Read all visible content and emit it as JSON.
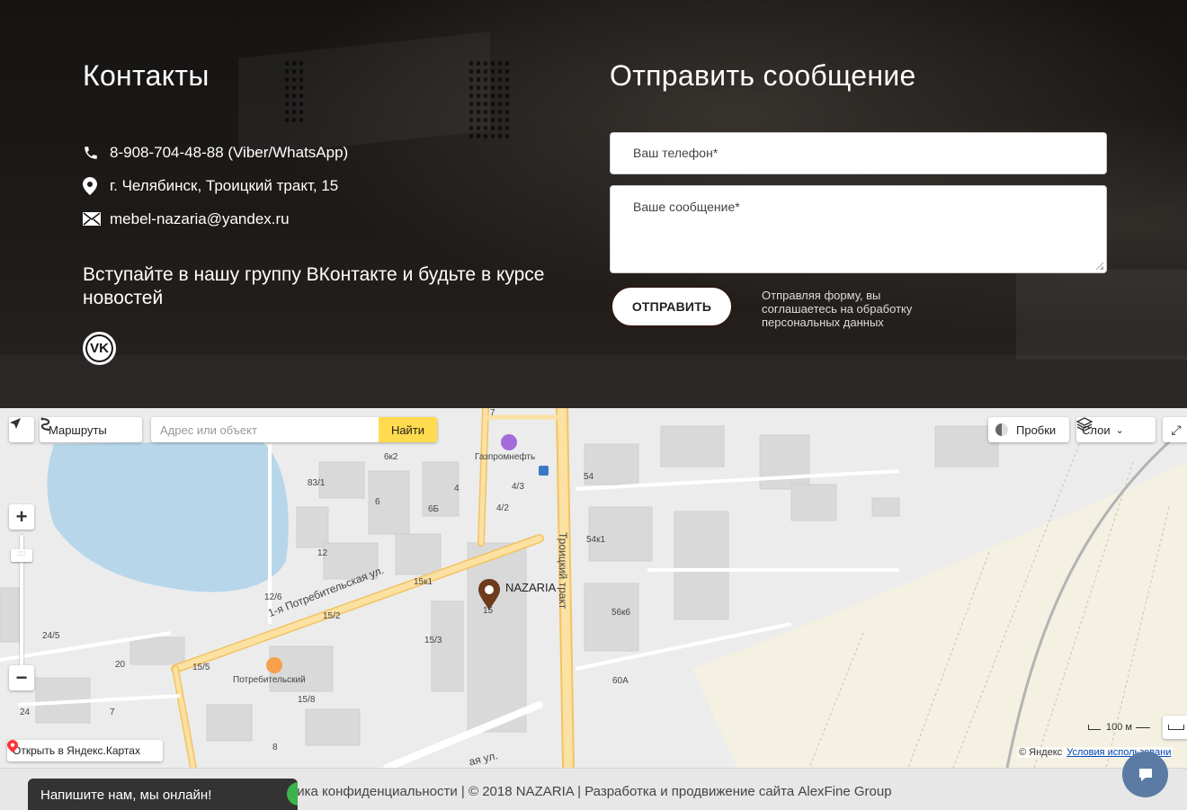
{
  "contacts": {
    "title": "Контакты",
    "phone": "8-908-704-48-88 (Viber/WhatsApp)",
    "address": "г. Челябинск, Троицкий тракт, 15",
    "email": "mebel-nazaria@yandex.ru",
    "join_text": "Вступайте в нашу группу ВКонтакте и будьте в курсе новостей",
    "vk_label": "VK"
  },
  "form": {
    "title": "Отправить сообщение",
    "phone_placeholder": "Ваш телефон*",
    "message_placeholder": "Ваше сообщение*",
    "submit_label": "ОТПРАВИТЬ",
    "agree_text": "Отправляя форму, вы соглашаетесь на обработку персональных данных"
  },
  "map": {
    "routes_label": "Маршруты",
    "search_placeholder": "Адрес или объект",
    "find_label": "Найти",
    "traffic_label": "Пробки",
    "layers_label": "Слои",
    "open_label": "Открыть в Яндекс.Картах",
    "scale_label": "100 м",
    "copyright": "© Яндекс",
    "terms_link": "Условия использовани",
    "marker_label": "NAZARIA",
    "labels": {
      "gazprom": "Газпромнефть",
      "potreb": "Потребительский",
      "street1": "1-я Потребительская ул.",
      "street_troitsky": "Троицкий тракт",
      "street_bottom": "ая ул.",
      "n7": "7",
      "n6k2": "6к2",
      "n83_1": "83/1",
      "n4": "4",
      "n4_3": "4/3",
      "n54": "54",
      "n6": "6",
      "n6b": "6Б",
      "n4_2": "4/2",
      "n54k1": "54к1",
      "n12": "12",
      "n15k1": "15к1",
      "n12_6": "12/6",
      "n15_2": "15/2",
      "n56k6": "56к6",
      "n24_5": "24/5",
      "n15_3": "15/3",
      "n20": "20",
      "n15_5": "15/5",
      "n60a": "60А",
      "n15_8": "15/8",
      "n24": "24",
      "n7b": "7",
      "n8": "8",
      "n15": "15"
    }
  },
  "footer": {
    "text": "итика конфиденциальности | © 2018 NAZARIA | Разработка и продвижение сайта AlexFine Group",
    "chat_label": "Напишите нам, мы онлайн!"
  },
  "colors": {
    "lake": "#b7d6ea",
    "road": "#fbe1a2",
    "road_edge": "#f2c364",
    "sand": "#f4f0e2",
    "marker": "#6e3b1c",
    "find_button": "#ffdb4d"
  }
}
